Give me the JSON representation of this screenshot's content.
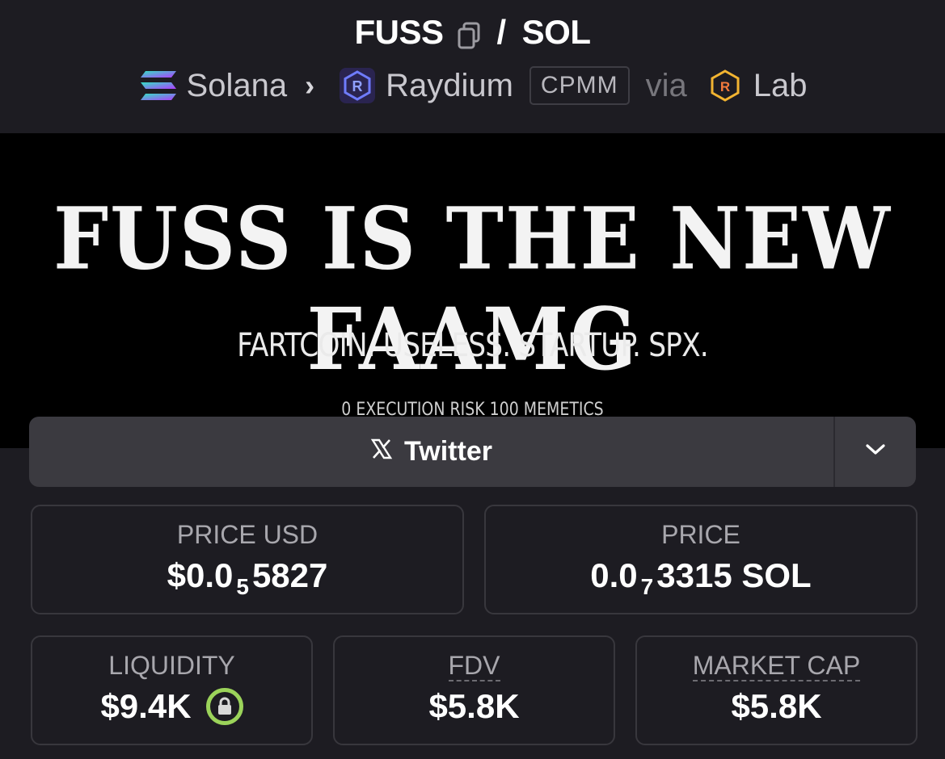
{
  "header": {
    "base_token": "FUSS",
    "separator": "/",
    "quote_token": "SOL",
    "chain": "Solana",
    "dex": "Raydium",
    "pool_type": "CPMM",
    "via": "via",
    "launchpad": "Lab"
  },
  "banner": {
    "headline": "FUSS IS THE NEW FAAMG",
    "subline": "FARTCOIN. USELESS. STARTUP. SPX.",
    "footer": "0 EXECUTION RISK 100 MEMETICS"
  },
  "social": {
    "label": "Twitter"
  },
  "stats": {
    "price_usd": {
      "label": "PRICE USD",
      "prefix": "$0.0",
      "zeros": "5",
      "digits": "5827"
    },
    "price": {
      "label": "PRICE",
      "prefix": "0.0",
      "zeros": "7",
      "digits": "3315 SOL"
    },
    "liquidity": {
      "label": "LIQUIDITY",
      "value": "$9.4K"
    },
    "fdv": {
      "label": "FDV",
      "value": "$5.8K"
    },
    "market_cap": {
      "label": "MARKET CAP",
      "value": "$5.8K"
    }
  },
  "colors": {
    "background": "#1d1c22",
    "card_border": "#38373d",
    "social_bar": "#3b3a40",
    "lock_ring": "#9bd35a"
  },
  "icons": [
    "copy-icon",
    "solana-icon",
    "raydium-icon",
    "lab-icon",
    "x-icon",
    "chevron-down-icon",
    "lock-icon"
  ]
}
